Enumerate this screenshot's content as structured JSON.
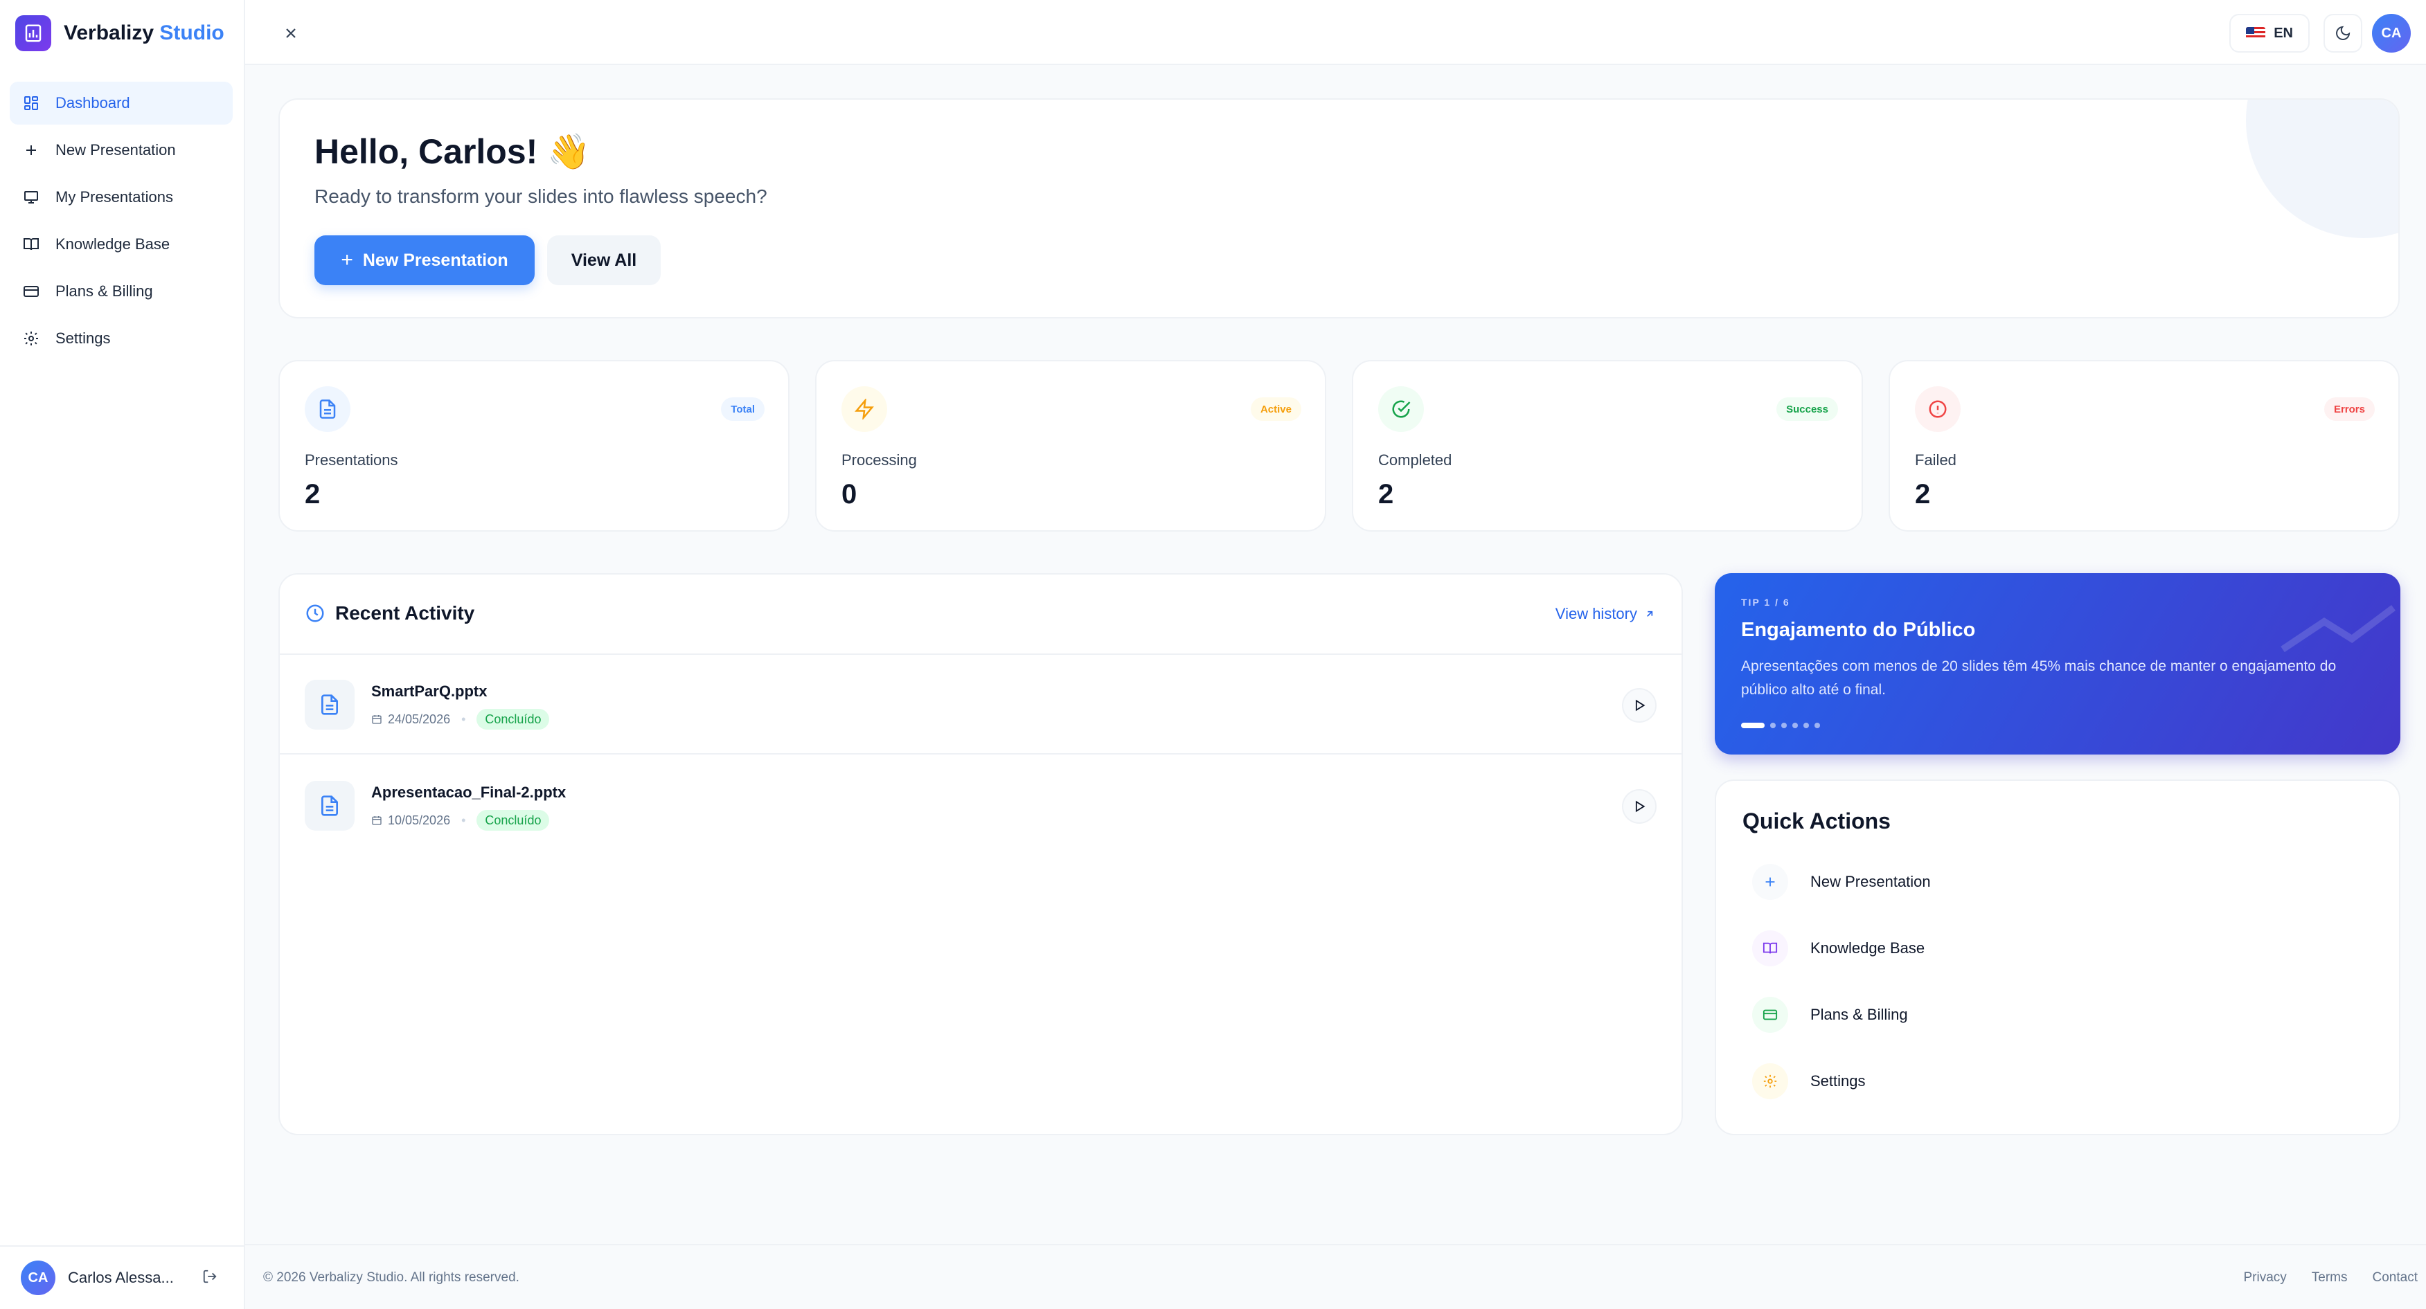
{
  "brand": {
    "name": "Verbalizy",
    "accent": "Studio"
  },
  "sidebar": {
    "items": [
      {
        "label": "Dashboard"
      },
      {
        "label": "New Presentation"
      },
      {
        "label": "My Presentations"
      },
      {
        "label": "Knowledge Base"
      },
      {
        "label": "Plans & Billing"
      },
      {
        "label": "Settings"
      }
    ],
    "user": {
      "initials": "CA",
      "name": "Carlos Alessa..."
    }
  },
  "topbar": {
    "language": "EN",
    "avatar": "CA"
  },
  "hero": {
    "title": "Hello, Carlos! 👋",
    "subtitle": "Ready to transform your slides into flawless speech?",
    "primary_button": "New Presentation",
    "secondary_button": "View All"
  },
  "stats": [
    {
      "label": "Presentations",
      "value": "2",
      "badge": "Total",
      "color": "#3b82f6"
    },
    {
      "label": "Processing",
      "value": "0",
      "badge": "Active",
      "color": "#f59e0b"
    },
    {
      "label": "Completed",
      "value": "2",
      "badge": "Success",
      "color": "#16a34a"
    },
    {
      "label": "Failed",
      "value": "2",
      "badge": "Errors",
      "color": "#ef4444"
    }
  ],
  "activity": {
    "title": "Recent Activity",
    "view_history": "View history",
    "items": [
      {
        "name": "SmartParQ.pptx",
        "date": "24/05/2026",
        "status": "Concluído"
      },
      {
        "name": "Apresentacao_Final-2.pptx",
        "date": "10/05/2026",
        "status": "Concluído"
      }
    ]
  },
  "tip": {
    "counter": "TIP 1 / 6",
    "title": "Engajamento do Público",
    "text": "Apresentações com menos de 20 slides têm 45% mais chance de manter o engajamento do público alto até o final.",
    "total": 6,
    "current": 1
  },
  "quick_actions": {
    "title": "Quick Actions",
    "items": [
      {
        "label": "New Presentation"
      },
      {
        "label": "Knowledge Base"
      },
      {
        "label": "Plans & Billing"
      },
      {
        "label": "Settings"
      }
    ]
  },
  "footer": {
    "copyright": "© 2026 Verbalizy Studio. All rights reserved.",
    "links": [
      "Privacy",
      "Terms",
      "Contact"
    ]
  },
  "colors": {
    "primary": "#3b82f6",
    "tip_start": "#2563eb",
    "tip_end": "#4338ca"
  }
}
